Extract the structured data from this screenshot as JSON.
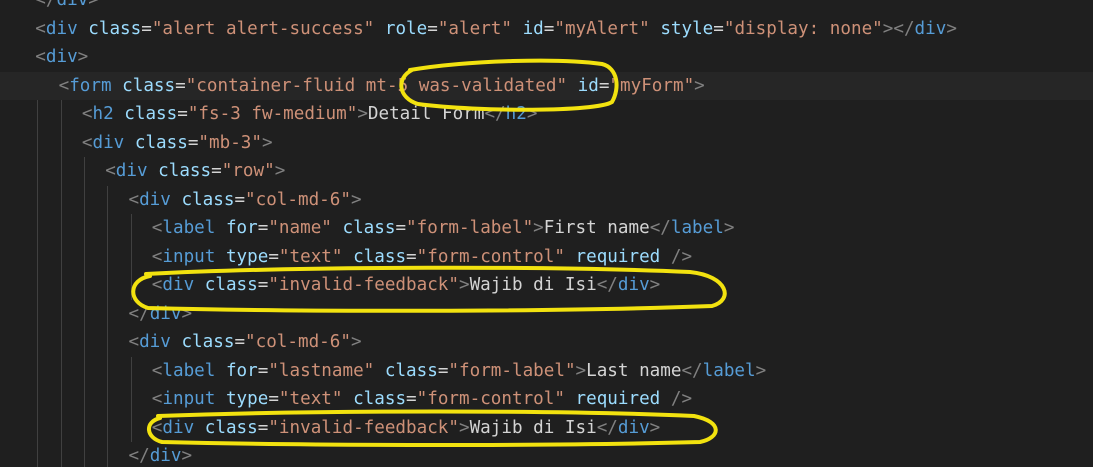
{
  "code_lines": [
    {
      "indent": 1,
      "tokens": [
        [
          "b",
          "</"
        ],
        [
          "t",
          "div"
        ],
        [
          "b",
          ">"
        ]
      ]
    },
    {
      "indent": 1,
      "tokens": [
        [
          "b",
          "<"
        ],
        [
          "t",
          "div"
        ],
        [
          "x",
          " "
        ],
        [
          "a",
          "class"
        ],
        [
          "e",
          "="
        ],
        [
          "s",
          "\"alert alert-success\""
        ],
        [
          "x",
          " "
        ],
        [
          "a",
          "role"
        ],
        [
          "e",
          "="
        ],
        [
          "s",
          "\"alert\""
        ],
        [
          "x",
          " "
        ],
        [
          "a",
          "id"
        ],
        [
          "e",
          "="
        ],
        [
          "s",
          "\"myAlert\""
        ],
        [
          "x",
          " "
        ],
        [
          "a",
          "style"
        ],
        [
          "e",
          "="
        ],
        [
          "s",
          "\"display: none\""
        ],
        [
          "b",
          "></"
        ],
        [
          "t",
          "div"
        ],
        [
          "b",
          ">"
        ]
      ]
    },
    {
      "indent": 1,
      "tokens": [
        [
          "b",
          "<"
        ],
        [
          "t",
          "div"
        ],
        [
          "b",
          ">"
        ]
      ]
    },
    {
      "indent": 2,
      "tokens": [
        [
          "b",
          "<"
        ],
        [
          "t",
          "form"
        ],
        [
          "x",
          " "
        ],
        [
          "a",
          "class"
        ],
        [
          "e",
          "="
        ],
        [
          "s",
          "\"container-fluid mt-5 was-validated\""
        ],
        [
          "x",
          " "
        ],
        [
          "a",
          "id"
        ],
        [
          "e",
          "="
        ],
        [
          "s",
          "\"myForm\""
        ],
        [
          "b",
          ">"
        ]
      ]
    },
    {
      "indent": 3,
      "tokens": [
        [
          "b",
          "<"
        ],
        [
          "t",
          "h2"
        ],
        [
          "x",
          " "
        ],
        [
          "a",
          "class"
        ],
        [
          "e",
          "="
        ],
        [
          "s",
          "\"fs-3 fw-medium\""
        ],
        [
          "b",
          ">"
        ],
        [
          "x",
          "Detail Form"
        ],
        [
          "b",
          "</"
        ],
        [
          "t",
          "h2"
        ],
        [
          "b",
          ">"
        ]
      ]
    },
    {
      "indent": 3,
      "tokens": [
        [
          "b",
          "<"
        ],
        [
          "t",
          "div"
        ],
        [
          "x",
          " "
        ],
        [
          "a",
          "class"
        ],
        [
          "e",
          "="
        ],
        [
          "s",
          "\"mb-3\""
        ],
        [
          "b",
          ">"
        ]
      ]
    },
    {
      "indent": 4,
      "tokens": [
        [
          "b",
          "<"
        ],
        [
          "t",
          "div"
        ],
        [
          "x",
          " "
        ],
        [
          "a",
          "class"
        ],
        [
          "e",
          "="
        ],
        [
          "s",
          "\"row\""
        ],
        [
          "b",
          ">"
        ]
      ]
    },
    {
      "indent": 5,
      "tokens": [
        [
          "b",
          "<"
        ],
        [
          "t",
          "div"
        ],
        [
          "x",
          " "
        ],
        [
          "a",
          "class"
        ],
        [
          "e",
          "="
        ],
        [
          "s",
          "\"col-md-6\""
        ],
        [
          "b",
          ">"
        ]
      ]
    },
    {
      "indent": 6,
      "tokens": [
        [
          "b",
          "<"
        ],
        [
          "t",
          "label"
        ],
        [
          "x",
          " "
        ],
        [
          "a",
          "for"
        ],
        [
          "e",
          "="
        ],
        [
          "s",
          "\"name\""
        ],
        [
          "x",
          " "
        ],
        [
          "a",
          "class"
        ],
        [
          "e",
          "="
        ],
        [
          "s",
          "\"form-label\""
        ],
        [
          "b",
          ">"
        ],
        [
          "x",
          "First name"
        ],
        [
          "b",
          "</"
        ],
        [
          "t",
          "label"
        ],
        [
          "b",
          ">"
        ]
      ]
    },
    {
      "indent": 6,
      "tokens": [
        [
          "b",
          "<"
        ],
        [
          "t",
          "input"
        ],
        [
          "x",
          " "
        ],
        [
          "a",
          "type"
        ],
        [
          "e",
          "="
        ],
        [
          "s",
          "\"text\""
        ],
        [
          "x",
          " "
        ],
        [
          "a",
          "class"
        ],
        [
          "e",
          "="
        ],
        [
          "s",
          "\"form-control\""
        ],
        [
          "x",
          " "
        ],
        [
          "a",
          "required"
        ],
        [
          "x",
          " "
        ],
        [
          "b",
          "/>"
        ]
      ]
    },
    {
      "indent": 6,
      "tokens": [
        [
          "b",
          "<"
        ],
        [
          "t",
          "div"
        ],
        [
          "x",
          " "
        ],
        [
          "a",
          "class"
        ],
        [
          "e",
          "="
        ],
        [
          "s",
          "\"invalid-feedback\""
        ],
        [
          "b",
          ">"
        ],
        [
          "x",
          "Wajib di Isi"
        ],
        [
          "b",
          "</"
        ],
        [
          "t",
          "div"
        ],
        [
          "b",
          ">"
        ]
      ]
    },
    {
      "indent": 5,
      "tokens": [
        [
          "b",
          "</"
        ],
        [
          "t",
          "div"
        ],
        [
          "b",
          ">"
        ]
      ]
    },
    {
      "indent": 5,
      "tokens": [
        [
          "b",
          "<"
        ],
        [
          "t",
          "div"
        ],
        [
          "x",
          " "
        ],
        [
          "a",
          "class"
        ],
        [
          "e",
          "="
        ],
        [
          "s",
          "\"col-md-6\""
        ],
        [
          "b",
          ">"
        ]
      ]
    },
    {
      "indent": 6,
      "tokens": [
        [
          "b",
          "<"
        ],
        [
          "t",
          "label"
        ],
        [
          "x",
          " "
        ],
        [
          "a",
          "for"
        ],
        [
          "e",
          "="
        ],
        [
          "s",
          "\"lastname\""
        ],
        [
          "x",
          " "
        ],
        [
          "a",
          "class"
        ],
        [
          "e",
          "="
        ],
        [
          "s",
          "\"form-label\""
        ],
        [
          "b",
          ">"
        ],
        [
          "x",
          "Last name"
        ],
        [
          "b",
          "</"
        ],
        [
          "t",
          "label"
        ],
        [
          "b",
          ">"
        ]
      ]
    },
    {
      "indent": 6,
      "tokens": [
        [
          "b",
          "<"
        ],
        [
          "t",
          "input"
        ],
        [
          "x",
          " "
        ],
        [
          "a",
          "type"
        ],
        [
          "e",
          "="
        ],
        [
          "s",
          "\"text\""
        ],
        [
          "x",
          " "
        ],
        [
          "a",
          "class"
        ],
        [
          "e",
          "="
        ],
        [
          "s",
          "\"form-control\""
        ],
        [
          "x",
          " "
        ],
        [
          "a",
          "required"
        ],
        [
          "x",
          " "
        ],
        [
          "b",
          "/>"
        ]
      ]
    },
    {
      "indent": 6,
      "tokens": [
        [
          "b",
          "<"
        ],
        [
          "t",
          "div"
        ],
        [
          "x",
          " "
        ],
        [
          "a",
          "class"
        ],
        [
          "e",
          "="
        ],
        [
          "s",
          "\"invalid-feedback\""
        ],
        [
          "b",
          ">"
        ],
        [
          "x",
          "Wajib di Isi"
        ],
        [
          "b",
          "</"
        ],
        [
          "t",
          "div"
        ],
        [
          "b",
          ">"
        ]
      ]
    },
    {
      "indent": 5,
      "tokens": [
        [
          "b",
          "</"
        ],
        [
          "t",
          "div"
        ],
        [
          "b",
          ">"
        ]
      ]
    }
  ],
  "active_line": 3,
  "colors": {
    "background": "#1f1f1f",
    "bracket": "#808080",
    "tag": "#569cd6",
    "attribute": "#9cdcfe",
    "string": "#ce9178",
    "text": "#d4d4d4",
    "highlight": "#f2e20f"
  },
  "annotations": [
    {
      "name": "highlight-was-validated",
      "target": "line-3"
    },
    {
      "name": "highlight-invalid-feedback-first",
      "target": "line-10"
    },
    {
      "name": "highlight-invalid-feedback-last",
      "target": "line-15"
    }
  ]
}
